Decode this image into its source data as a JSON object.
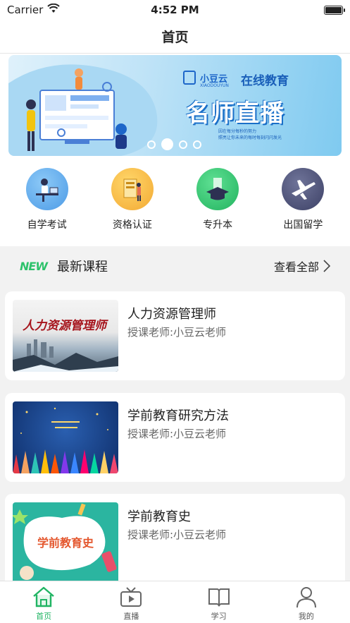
{
  "status_bar": {
    "carrier": "Carrier",
    "time": "4:52 PM"
  },
  "nav": {
    "title": "首页"
  },
  "banner": {
    "brand": "小豆云",
    "brand_sub": "XIAODOUYUN",
    "online": "在线教育",
    "headline": "名师直播",
    "small_line_1": "因在每分每秒的努力",
    "small_line_2": "照亮让你未来的每时每刻闪闪发光",
    "slide_count": 4,
    "active_slide": 1
  },
  "categories": [
    {
      "label": "自学考试",
      "icon": "self-study-icon",
      "color": "#5aa9ec"
    },
    {
      "label": "资格认证",
      "icon": "certification-icon",
      "color": "#f6b93b"
    },
    {
      "label": "专升本",
      "icon": "graduation-cap-icon",
      "color": "#2fbf6a"
    },
    {
      "label": "出国留学",
      "icon": "airplane-icon",
      "color": "#4a4e7a"
    }
  ],
  "section": {
    "badge": "NEW",
    "title": "最新课程",
    "view_all": "查看全部"
  },
  "courses": [
    {
      "title": "人力资源管理师",
      "teacher": "授课老师:小豆云老师",
      "thumb_text": "人力资源管理师"
    },
    {
      "title": "学前教育研究方法",
      "teacher": "授课老师:小豆云老师",
      "thumb_text": ""
    },
    {
      "title": "学前教育史",
      "teacher": "授课老师:小豆云老师",
      "thumb_text": "学前教育史"
    }
  ],
  "tabs": [
    {
      "label": "首页",
      "icon": "home-icon",
      "active": true
    },
    {
      "label": "直播",
      "icon": "tv-icon",
      "active": false
    },
    {
      "label": "学习",
      "icon": "book-icon",
      "active": false
    },
    {
      "label": "我的",
      "icon": "user-icon",
      "active": false
    }
  ],
  "colors": {
    "accent": "#20b463",
    "banner_blue": "#1a5fb9"
  }
}
